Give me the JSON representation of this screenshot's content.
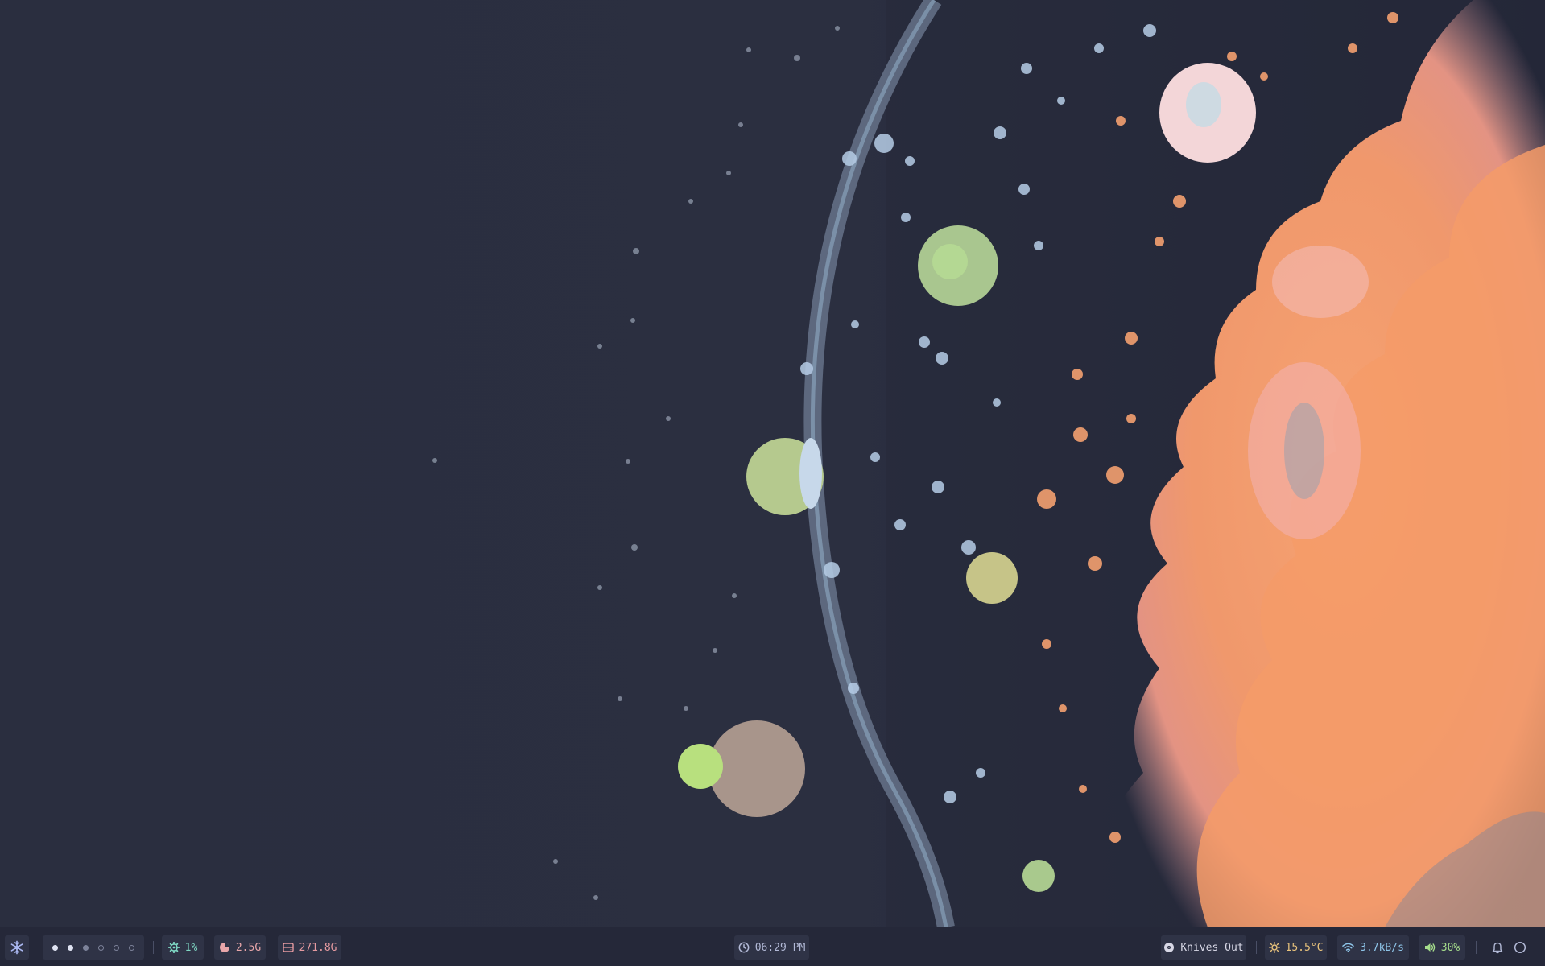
{
  "colors": {
    "desktop_bg": "#2a2e3f",
    "bar_bg": "#252839",
    "module_bg": "#2f3346",
    "launcher": "#a9b6ef",
    "cpu": "#7fd8c4",
    "memory": "#e8a6a9",
    "disk": "#e59aa0",
    "clock": "#b2b9d6",
    "media": "#d8d8e6",
    "temperature": "#e9c37c",
    "network": "#8fc6ea",
    "volume": "#a6de8c",
    "tray": "#b2b9d6"
  },
  "taskbar": {
    "launcher_icon": "snowflake-icon",
    "workspaces": [
      {
        "state": "active"
      },
      {
        "state": "occupied"
      },
      {
        "state": "occupied-dim"
      },
      {
        "state": "empty"
      },
      {
        "state": "empty"
      },
      {
        "state": "empty"
      }
    ],
    "cpu": {
      "icon": "gear-icon",
      "value": "1%"
    },
    "memory": {
      "icon": "pie-chart-icon",
      "value": "2.5G"
    },
    "disk": {
      "icon": "drive-icon",
      "value": "271.8G"
    },
    "clock": {
      "icon": "clock-icon",
      "value": "06:29 PM"
    },
    "media": {
      "icon": "disc-icon",
      "value": "Knives Out"
    },
    "temperature": {
      "icon": "sun-icon",
      "value": "15.5°C"
    },
    "network": {
      "icon": "wifi-icon",
      "value": "3.7kB/s"
    },
    "volume": {
      "icon": "speaker-icon",
      "value": "30%"
    },
    "notifications": {
      "icon": "bell-icon"
    },
    "power": {
      "icon": "circle-icon"
    }
  }
}
